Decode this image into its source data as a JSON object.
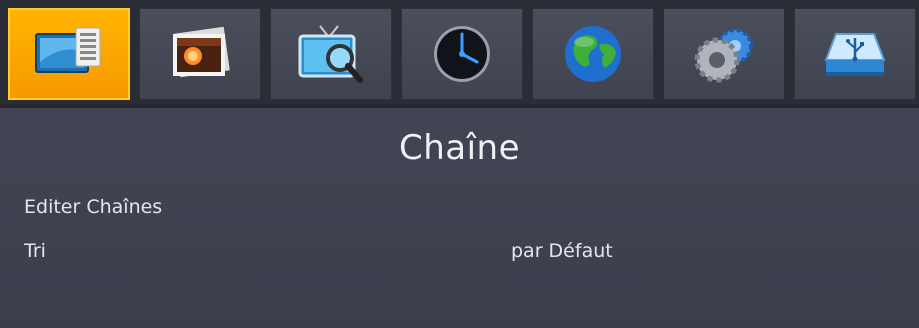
{
  "tabs": [
    {
      "key": "channel",
      "icon": "channel-list-icon",
      "active": true
    },
    {
      "key": "media",
      "icon": "photo-icon",
      "active": false
    },
    {
      "key": "search",
      "icon": "tv-search-icon",
      "active": false
    },
    {
      "key": "time",
      "icon": "clock-icon",
      "active": false
    },
    {
      "key": "region",
      "icon": "globe-icon",
      "active": false
    },
    {
      "key": "settings",
      "icon": "gears-icon",
      "active": false
    },
    {
      "key": "usb",
      "icon": "usb-drive-icon",
      "active": false
    }
  ],
  "page": {
    "title": "Chaîne"
  },
  "menu": [
    {
      "label": "Editer Chaînes",
      "value": ""
    },
    {
      "label": "Tri",
      "value": "par Défaut"
    }
  ],
  "colors": {
    "accent": "#ffb400",
    "background": "#3d4150",
    "text": "#e8e8ee"
  }
}
